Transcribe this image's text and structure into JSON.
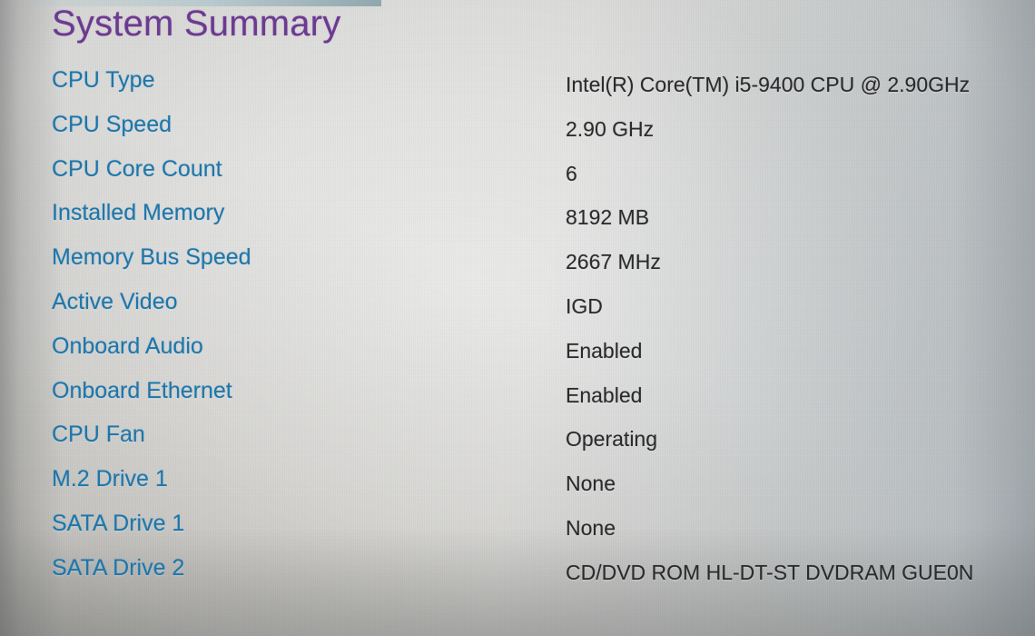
{
  "screen": {
    "title": "System Summary",
    "title_color": "#6c3a90",
    "label_color": "#1f76a9",
    "value_color": "#2b2b2d",
    "background_color": "#d8d8d6"
  },
  "rows": [
    {
      "label": "CPU Type",
      "value": "Intel(R) Core(TM) i5-9400 CPU @ 2.90GHz"
    },
    {
      "label": "CPU Speed",
      "value": "2.90 GHz"
    },
    {
      "label": "CPU Core Count",
      "value": "6"
    },
    {
      "label": "Installed Memory",
      "value": "8192 MB"
    },
    {
      "label": "Memory Bus Speed",
      "value": "2667 MHz"
    },
    {
      "label": "Active Video",
      "value": "IGD"
    },
    {
      "label": "Onboard Audio",
      "value": "Enabled"
    },
    {
      "label": "Onboard Ethernet",
      "value": "Enabled"
    },
    {
      "label": "CPU Fan",
      "value": "Operating"
    },
    {
      "label": "M.2 Drive 1",
      "value": "None"
    },
    {
      "label": "SATA Drive 1",
      "value": "None"
    },
    {
      "label": "SATA Drive 2",
      "value": "CD/DVD ROM HL-DT-ST DVDRAM GUE0N"
    }
  ]
}
